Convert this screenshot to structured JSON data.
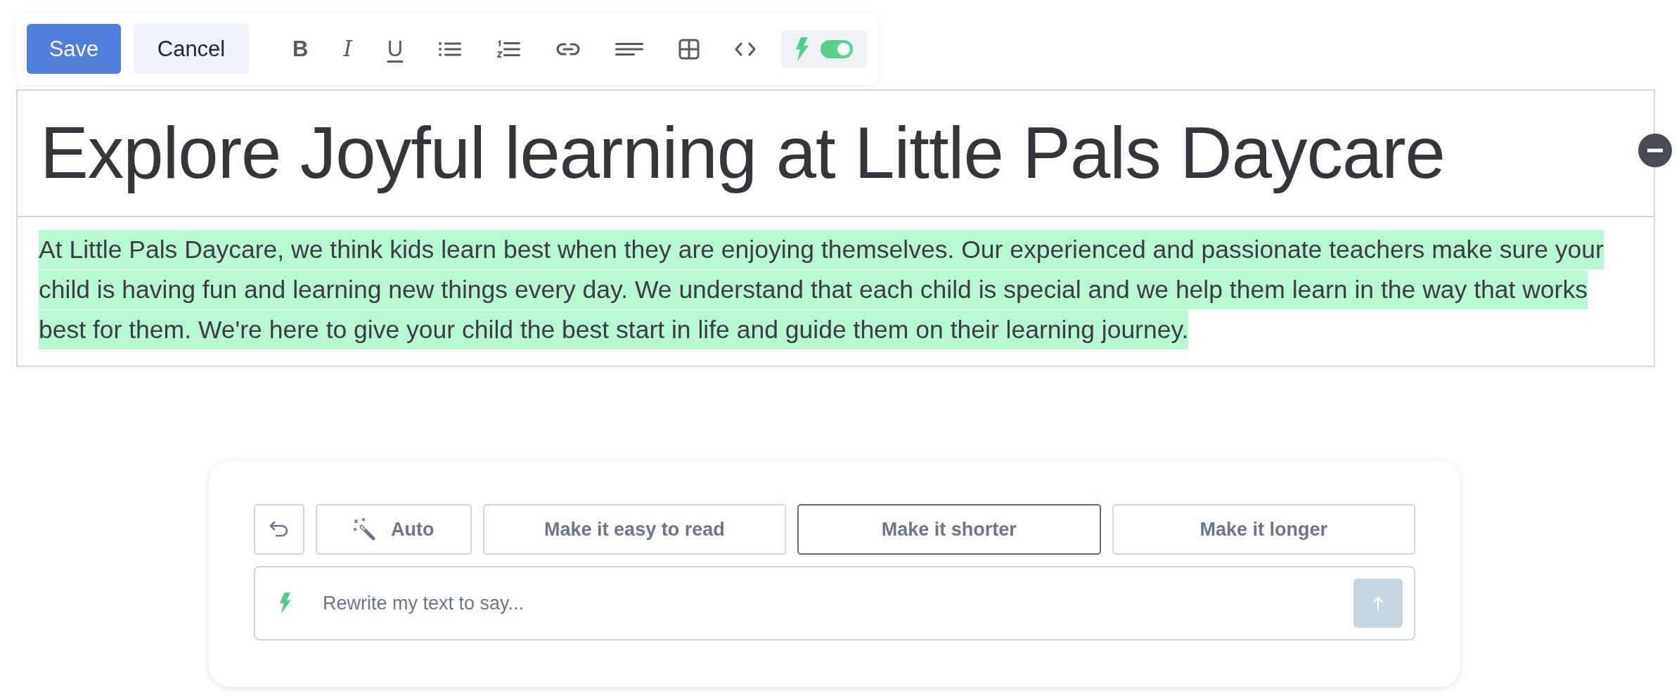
{
  "toolbar": {
    "buttons": [
      {
        "label": "Save",
        "kind": "primary"
      },
      {
        "label": "Cancel",
        "kind": "secondary"
      }
    ],
    "tools": [
      {
        "kind": "bold",
        "glyph": "B"
      },
      {
        "kind": "italic",
        "glyph": "I"
      },
      {
        "kind": "underline",
        "glyph": "U"
      },
      {
        "kind": "bullet-list"
      },
      {
        "kind": "numbered-list"
      },
      {
        "kind": "link"
      },
      {
        "kind": "align"
      },
      {
        "kind": "table"
      },
      {
        "kind": "code"
      }
    ],
    "ai_toggle": {
      "on": true
    }
  },
  "editor": {
    "title": "Explore Joyful learning at Little Pals Daycare",
    "paragraph": {
      "text": "At Little Pals Daycare, we think kids learn best when they are enjoying themselves. Our experienced and passionate teachers make sure your child is having fun and learning new things every day. We understand that each child is special and we help them learn in the way that works best for them. We're here to give your child the best start in life and guide them on their learning journey.",
      "highlighted": true
    }
  },
  "rewrite_panel": {
    "options": [
      {
        "kind": "undo",
        "selected": false
      },
      {
        "kind": "auto",
        "label": "Auto",
        "selected": false
      },
      {
        "kind": "text",
        "label": "Make it easy to read",
        "selected": false
      },
      {
        "kind": "text",
        "label": "Make it shorter",
        "selected": true
      },
      {
        "kind": "text",
        "label": "Make it longer",
        "selected": false
      }
    ],
    "prompt": {
      "placeholder": "Rewrite my text to say..."
    }
  }
}
